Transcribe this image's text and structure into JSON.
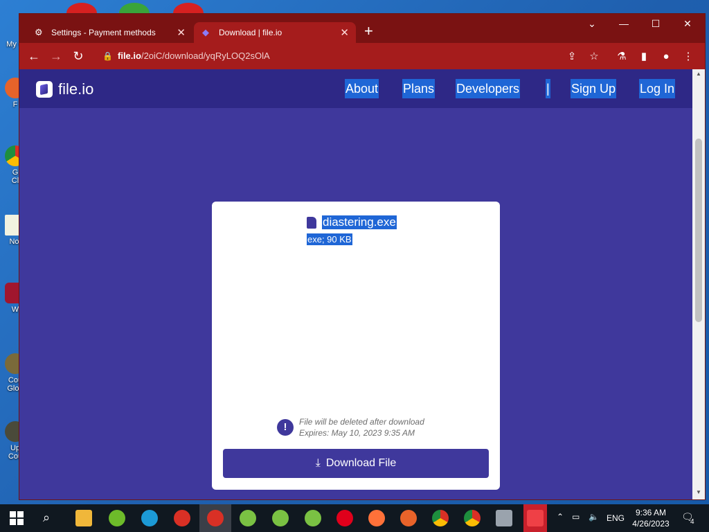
{
  "desktop": {
    "icons": [
      {
        "label": "My C"
      },
      {
        "label": "F"
      },
      {
        "label": "G"
      },
      {
        "label": "Cl"
      },
      {
        "label": "Not"
      },
      {
        "label": "W"
      },
      {
        "label": "Cou"
      },
      {
        "label": "Glob"
      },
      {
        "label": "Up"
      },
      {
        "label": "Cou"
      }
    ]
  },
  "browser": {
    "tabs": [
      {
        "label": "Settings - Payment methods",
        "icon": "gear-icon"
      },
      {
        "label": "Download | file.io",
        "icon": "file-io-icon"
      }
    ],
    "address": {
      "domain": "file.io",
      "path": "/2oiC/download/yqRyLOQ2sOlA"
    }
  },
  "site": {
    "logo_text": "file.io",
    "nav": [
      "About",
      "Plans",
      "Developers",
      "|",
      "Sign Up",
      "Log In"
    ]
  },
  "card": {
    "filename": "diastering.exe",
    "filemeta": "exe; 90 KB",
    "notice_line1": "File will be deleted after download",
    "notice_line2": "Expires: May 10, 2023 9:35 AM",
    "notice_icon": "!",
    "download_label": "Download File"
  },
  "taskbar": {
    "language": "ENG",
    "time": "9:36 AM",
    "date": "4/26/2023",
    "notification_count": "4",
    "pinned_apps": [
      "file-explorer",
      "utorrent",
      "edge",
      "chrome-b",
      "chrome-profile",
      "app-1",
      "app-2",
      "app-3",
      "opera",
      "firefox",
      "firefox-2",
      "chrome",
      "chrome-2",
      "app-4",
      "anydesk"
    ]
  },
  "colors": {
    "tab_bar": "#7a1212",
    "toolbar": "#a51c1c",
    "site_header": "#2e2886",
    "page_bg": "#3f389c",
    "selection": "#1f66d6"
  }
}
